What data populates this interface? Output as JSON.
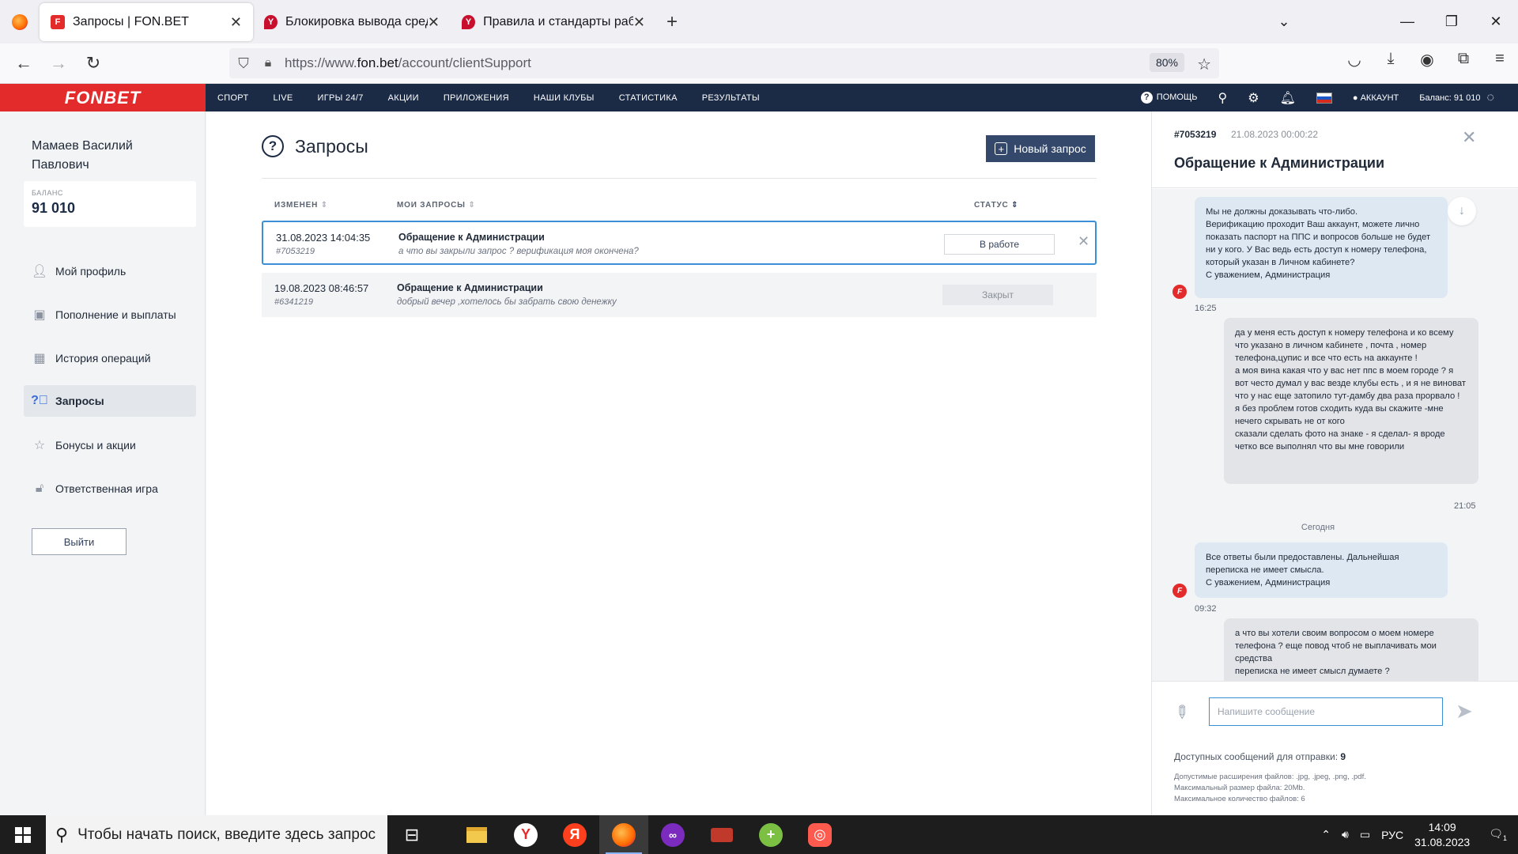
{
  "browser": {
    "tabs": [
      {
        "title": "Запросы | FON.BET",
        "active": true
      },
      {
        "title": "Блокировка вывода средств -",
        "active": false
      },
      {
        "title": "Правила и стандарты работы",
        "active": false
      }
    ],
    "url_prefix": "https://www.",
    "url_domain": "fon.bet",
    "url_path": "/account/clientSupport",
    "zoom": "80%"
  },
  "site": {
    "logo": "FONBET",
    "menu": [
      "СПОРТ",
      "LIVE",
      "ИГРЫ 24/7",
      "АКЦИИ",
      "ПРИЛОЖЕНИЯ",
      "НАШИ КЛУБЫ",
      "СТАТИСТИКА",
      "РЕЗУЛЬТАТЫ"
    ],
    "help": "ПОМОЩЬ",
    "account": "АККАУНТ",
    "balance": "Баланс: 91 010"
  },
  "sidebar": {
    "user_name_line1": "Мамаев Василий",
    "user_name_line2": "Павлович",
    "balance_label": "БАЛАНС",
    "balance_value": "91 010",
    "items": [
      {
        "label": "Мой профиль",
        "icon": "user-icon",
        "active": false
      },
      {
        "label": "Пополнение и выплаты",
        "icon": "wallet-icon",
        "active": false
      },
      {
        "label": "История операций",
        "icon": "grid-icon",
        "active": false
      },
      {
        "label": "Запросы",
        "icon": "question-icon",
        "active": true
      },
      {
        "label": "Бонусы и акции",
        "icon": "star-icon",
        "active": false
      },
      {
        "label": "Ответственная игра",
        "icon": "lock-icon",
        "active": false
      }
    ],
    "logout": "Выйти"
  },
  "main": {
    "title": "Запросы",
    "new_request": "Новый запрос",
    "columns": {
      "changed": "ИЗМЕНЕН",
      "requests": "МОИ ЗАПРОСЫ",
      "status": "СТАТУС"
    },
    "rows": [
      {
        "date": "31.08.2023 14:04:35",
        "id": "#7053219",
        "subject": "Обращение к Администрации",
        "preview": "а что вы закрыли запрос ? верификация моя окончена?",
        "status": "В работе"
      },
      {
        "date": "19.08.2023 08:46:57",
        "id": "#6341219",
        "subject": "Обращение к Администрации",
        "preview": "добрый вечер ,хотелось бы забрать свою денежку",
        "status": "Закрыт"
      }
    ]
  },
  "chat": {
    "id": "#7053219",
    "date": "21.08.2023 00:00:22",
    "title": "Обращение к Администрации",
    "messages": [
      {
        "author": "admin",
        "text": "Мы не должны доказывать что-либо.\nВерификацию проходит Ваш аккаунт, можете лично показать паспорт на ППС и вопросов больше не будет ни у кого. У Вас ведь есть доступ к номеру телефона, который указан в Личном кабинете?\nС уважением, Администрация",
        "time": "16:25"
      },
      {
        "author": "user",
        "text": "да у меня есть доступ к номеру телефона и ко всему что указано в личном кабинете , почта , номер телефона,цупис и все что есть на аккаунте !\nа моя вина какая что у вас нет ппс в моем городе ? я вот често думал у вас везде клубы есть , и я не виноват что у нас еще затопило тут-дамбу два раза прорвало !\nя без проблем готов сходить куда вы скажите -мне нечего скрывать не от кого\nсказали сделать фото на знаке - я сделал- я вроде четко все выполнял что вы мне говорили",
        "time": "21:05"
      },
      {
        "author": "admin",
        "text": "Все ответы были предоставлены. Дальнейшая переписка не имеет смысла.\nС уважением, Администрация",
        "time": "09:32"
      },
      {
        "author": "user",
        "text": "а что вы хотели своим вопросом о моем номере телефона ? еще повод чтоб не выплачивать мои средства\nпереписка не имеет смысл думаете ?",
        "time": ""
      }
    ],
    "day_separator": "Сегодня",
    "input_placeholder": "Напишите сообщение",
    "available_label": "Доступных сообщений для отправки:",
    "available_count": "9",
    "notes": [
      "Допустимые расширения файлов: .jpg, .jpeg, .png, .pdf.",
      "Максимальный размер файла: 20Mb.",
      "Максимальное количество файлов: 6"
    ]
  },
  "taskbar": {
    "search_placeholder": "Чтобы начать поиск, введите здесь запрос",
    "language": "РУС",
    "time": "14:09",
    "date": "31.08.2023",
    "notifications": "1"
  }
}
